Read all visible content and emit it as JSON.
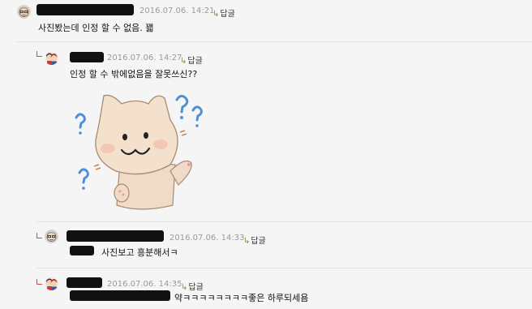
{
  "comments": [
    {
      "date": "2016.07.06. 14:21",
      "reply_label": "답글",
      "text": "사진봤는데 인정 할 수 없음. 꽯"
    },
    {
      "date": "2016.07.06. 14:27",
      "reply_label": "답글",
      "text": "인정 할 수 밖에없음을 잘못쓰신??"
    },
    {
      "date": "2016.07.06. 14:33",
      "reply_label": "답글",
      "text": "사진보고 흥분해서ㅋ"
    },
    {
      "date": "2016.07.06. 14:35",
      "reply_label": "답글",
      "text": "약ㅋㅋㅋㅋㅋㅋㅋㅋ좋은 하루되세욤"
    }
  ],
  "icons": {
    "reply_arrow": "reply-arrow-icon",
    "avatar_a": "grandpa-avatar-icon",
    "avatar_b": "couple-avatar-icon",
    "sticker": "confused-cat-sticker"
  },
  "colors": {
    "background": "#f5f5f5",
    "date": "#9a9a9a",
    "reply_arrow": "#7a9a4a",
    "indent_mark": "#d0503a"
  }
}
